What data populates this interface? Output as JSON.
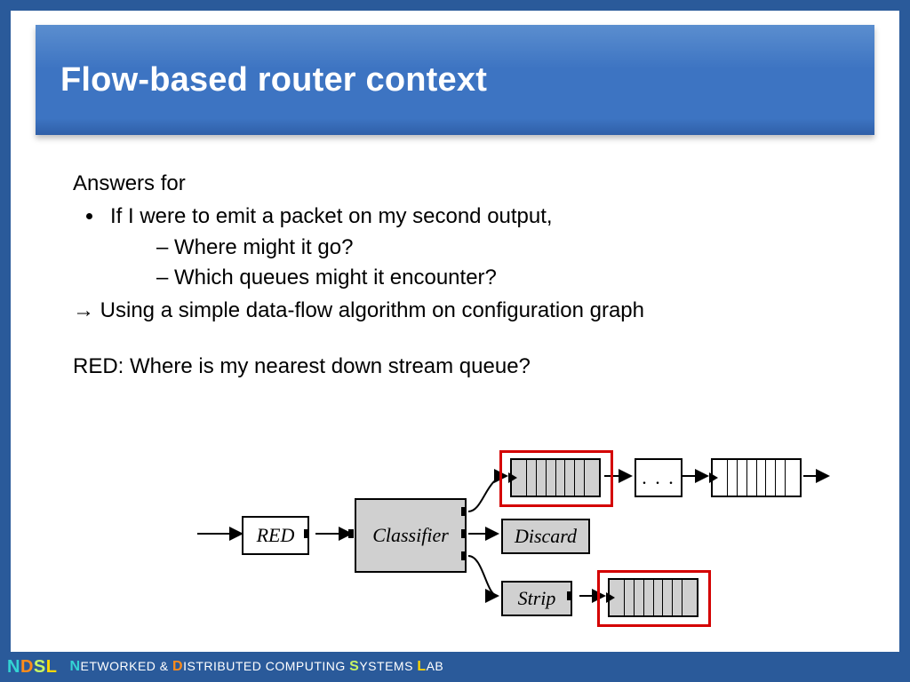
{
  "title": "Flow-based router context",
  "answers_for": "Answers for",
  "bullet1": "If I were to emit a packet on my second output,",
  "sub1": "Where might it go?",
  "sub2": "Which queues might it encounter?",
  "conclusion_arrow": "→",
  "conclusion": "Using a simple data-flow algorithm on configuration graph",
  "red_question": "RED: Where is my nearest down stream queue?",
  "diagram": {
    "red": "RED",
    "classifier": "Classifier",
    "discard": "Discard",
    "strip": "Strip",
    "dots": ". . ."
  },
  "footer": {
    "logo": [
      "N",
      "D",
      "S",
      "L"
    ],
    "text_parts": {
      "n": "N",
      "net": "ETWORKED & ",
      "d": "D",
      "dist": "ISTRIBUTED COMPUTING ",
      "s": "S",
      "sys": "YSTEMS ",
      "l": "L",
      "lab": "AB"
    }
  }
}
